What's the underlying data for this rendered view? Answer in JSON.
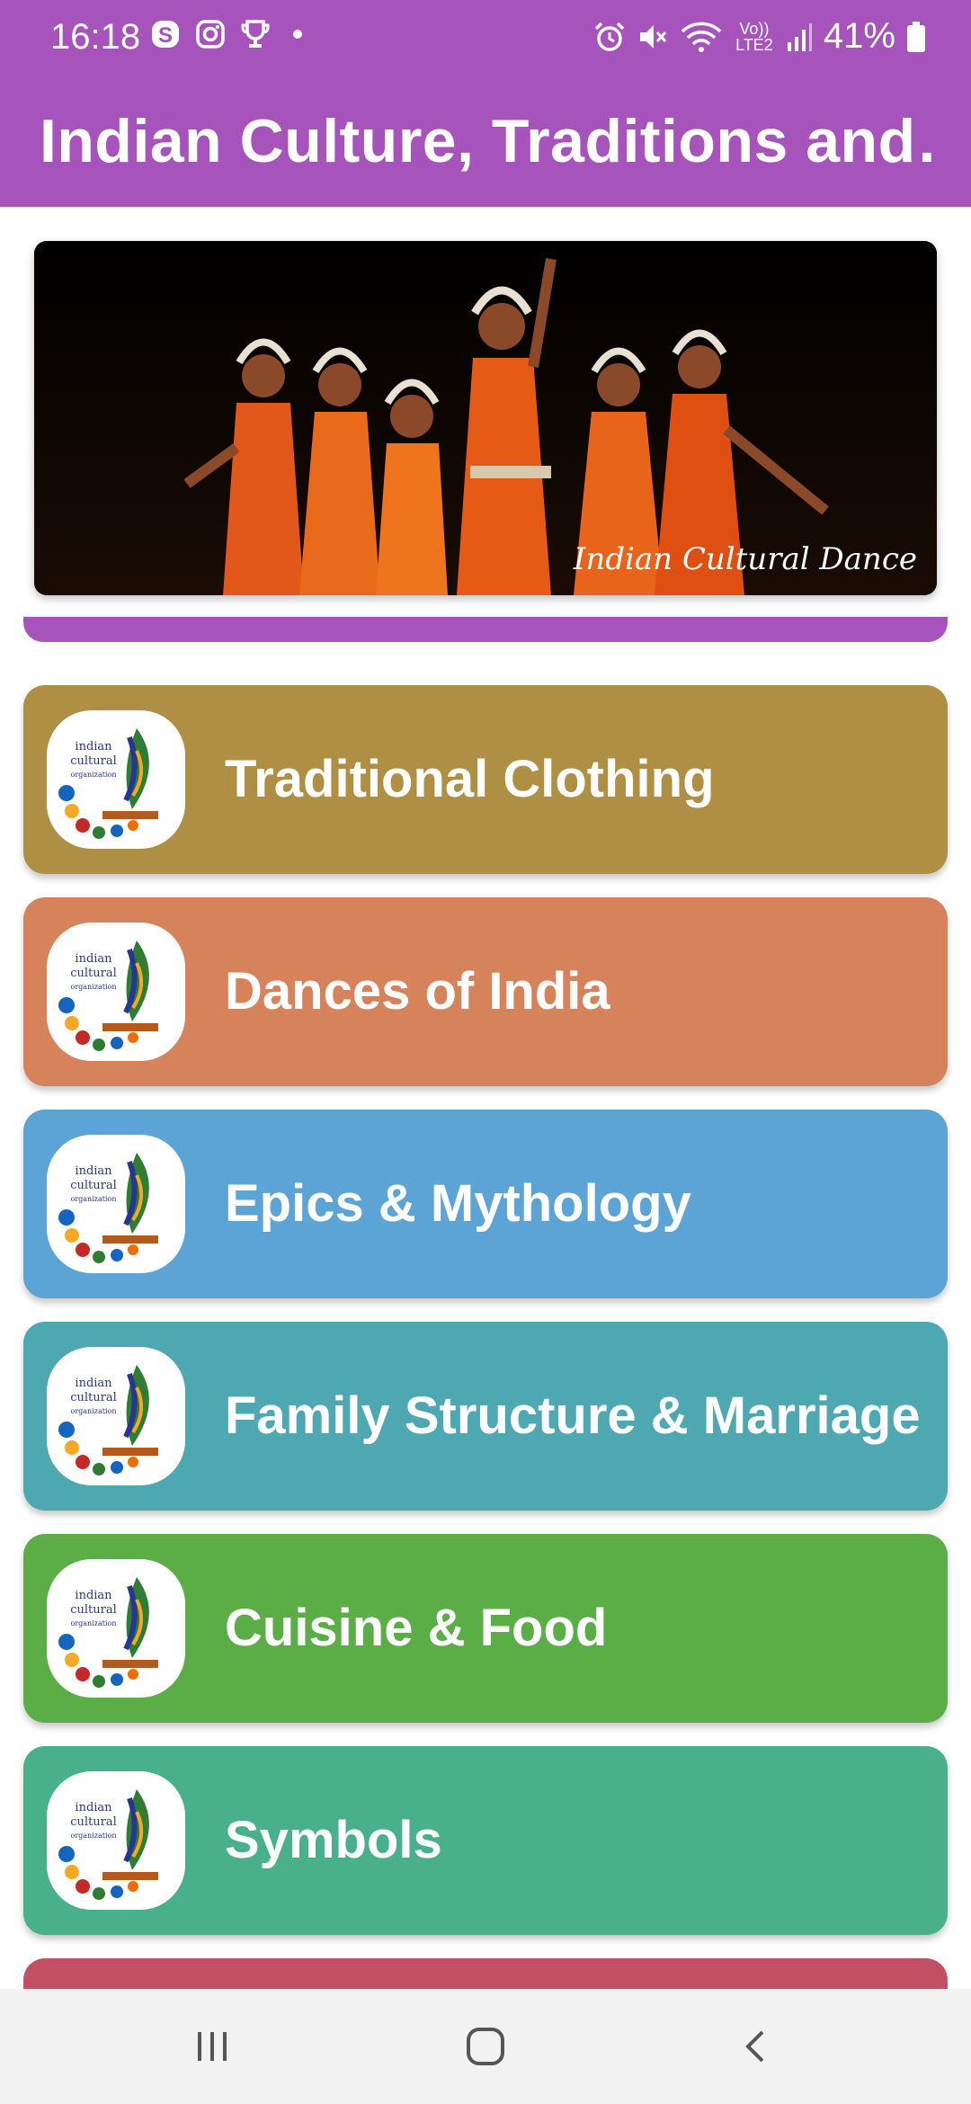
{
  "status_bar": {
    "time": "16:18",
    "battery": "41%",
    "left_icons": [
      "skype-icon",
      "instagram-icon",
      "trophy-icon",
      "dot-icon"
    ],
    "right_icons": [
      "alarm-icon",
      "mute-icon",
      "wifi-icon",
      "signal-icon",
      "battery-icon"
    ],
    "volte_label": "Vo)) LTE2"
  },
  "app_bar": {
    "title": "Indian Culture, Traditions and…",
    "color": "#a654bb"
  },
  "banner": {
    "caption": "Indian Cultural Dance"
  },
  "categories": [
    {
      "label": "Traditional Clothing",
      "color": "#ae8f43",
      "logo_text": [
        "indian",
        "cultural",
        "organization"
      ]
    },
    {
      "label": "Dances of India",
      "color": "#d6835b",
      "logo_text": [
        "indian",
        "cultural",
        "organization"
      ]
    },
    {
      "label": "Epics & Mythology",
      "color": "#5ca4d6",
      "logo_text": [
        "indian",
        "cultural",
        "organization"
      ]
    },
    {
      "label": "Family Structure & Marriage",
      "color": "#4ea8b1",
      "logo_text": [
        "indian",
        "cultural",
        "organization"
      ]
    },
    {
      "label": "Cuisine & Food",
      "color": "#5aae45",
      "logo_text": [
        "indian",
        "cultural",
        "organization"
      ]
    },
    {
      "label": "Symbols",
      "color": "#48b08b",
      "logo_text": [
        "indian",
        "cultural",
        "organization"
      ]
    }
  ],
  "nav_bar": {
    "buttons": [
      "recent-apps",
      "home",
      "back"
    ]
  }
}
